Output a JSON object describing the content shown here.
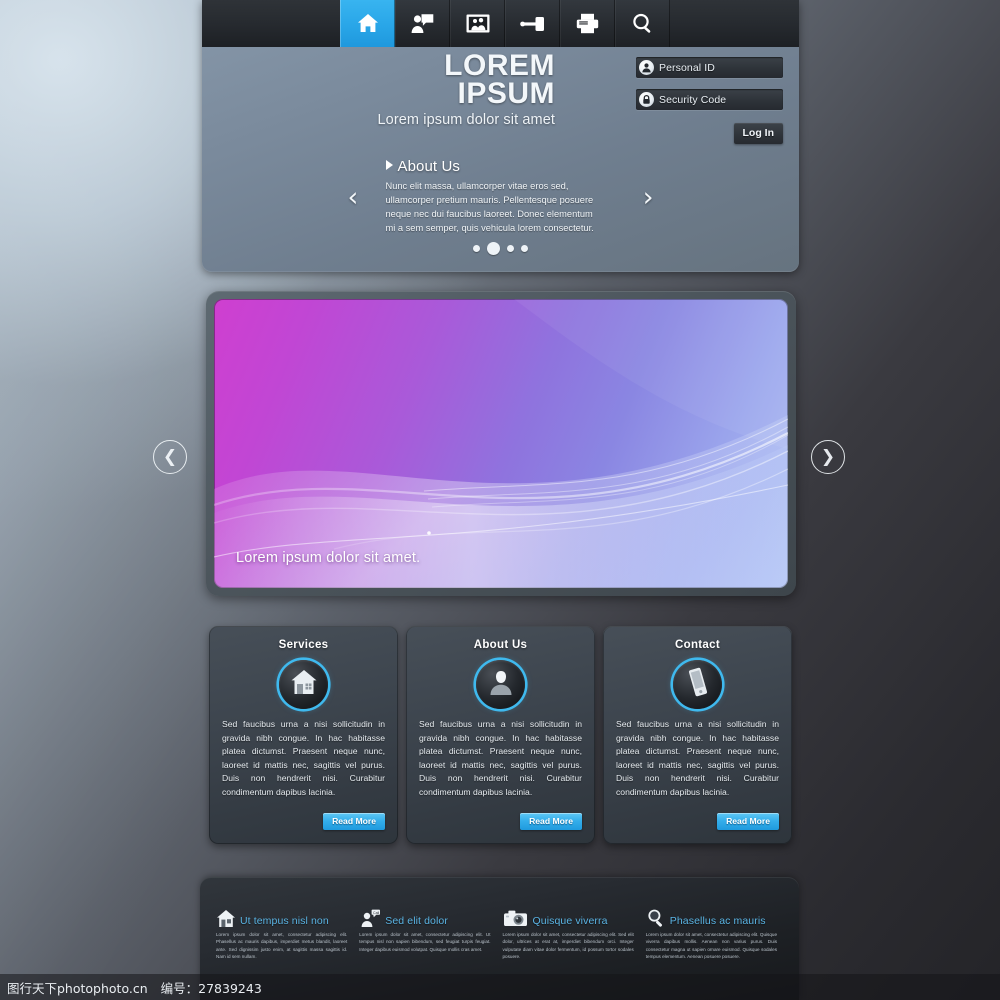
{
  "nav": {
    "items": [
      {
        "name": "home",
        "icon": "home-icon",
        "active": true
      },
      {
        "name": "messages",
        "icon": "user-speech-bubble-icon",
        "active": false
      },
      {
        "name": "gallery",
        "icon": "photo-frame-icon",
        "active": false
      },
      {
        "name": "access",
        "icon": "key-icon",
        "active": false
      },
      {
        "name": "print",
        "icon": "printer-icon",
        "active": false
      },
      {
        "name": "search",
        "icon": "magnifier-icon",
        "active": false
      }
    ]
  },
  "brand": {
    "line1": "LOREM",
    "line2": "IPSUM",
    "tagline": "Lorem ipsum dolor sit amet"
  },
  "login": {
    "personal_id_label": "Personal ID",
    "personal_id_value": "",
    "security_code_label": "Security Code",
    "security_code_value": "",
    "login_button": "Log In",
    "user_icon": "user-avatar-icon",
    "lock_icon": "padlock-icon"
  },
  "about_slider": {
    "title": "About Us",
    "body": "Nunc elit massa, ullamcorper vitae eros sed, ullamcorper pretium mauris. Pellentesque posuere neque nec dui faucibus laoreet. Donec elementum mi a sem semper, quis vehicula lorem consectetur.",
    "prev_glyph": "‹",
    "next_glyph": "›",
    "dots": 4,
    "active_dot": 1
  },
  "banner": {
    "caption": "Lorem ipsum dolor sit amet.",
    "prev_glyph": "❮",
    "next_glyph": "❯",
    "colors": {
      "magenta": "#cf3fd0",
      "violet": "#8f73de",
      "periwinkle": "#b0c2f4"
    }
  },
  "cards": [
    {
      "title": "Services",
      "icon": "house-icon",
      "text": "Sed faucibus urna a nisi sollicitudin in gravida nibh congue. In hac habitasse platea dictumst. Praesent neque nunc, laoreet id mattis nec, sagittis vel purus. Duis non hendrerit nisi. Curabitur condimentum dapibus lacinia.",
      "button": "Read More"
    },
    {
      "title": "About Us",
      "icon": "person-silhouette-icon",
      "text": "Sed faucibus urna a nisi sollicitudin in gravida nibh congue. In hac habitasse platea dictumst. Praesent neque nunc, laoreet id mattis nec, sagittis vel purus. Duis non hendrerit nisi. Curabitur condimentum dapibus lacinia.",
      "button": "Read More"
    },
    {
      "title": "Contact",
      "icon": "mobile-phone-icon",
      "text": "Sed faucibus urna a nisi sollicitudin in gravida nibh congue. In hac habitasse platea dictumst. Praesent neque nunc, laoreet id mattis nec, sagittis vel purus. Duis non hendrerit nisi. Curabitur condimentum dapibus lacinia.",
      "button": "Read More"
    }
  ],
  "footer": [
    {
      "title": "Ut tempus nisl non",
      "icon": "house-icon",
      "text": "Lorem ipsum dolor sit amet, consectetur adipiscing elit. Phasellus ac mauris dapibus, imperdiet metus blandit, laoreet ante. Sed dignissim justo enim, at sagittis massa sagittis id. Nam id sem nullam."
    },
    {
      "title": "Sed elit dolor",
      "icon": "person-call-icon",
      "text": "Lorem ipsum dolor sit amet, consectetur adipiscing elit. Ut tempus nisl non sapien bibendum, sed feugiat turpis feugiat. Integer dapibus euismod volutpat. Quisque mollis cras amet."
    },
    {
      "title": "Quisque viverra",
      "icon": "camera-icon",
      "text": "Lorem ipsum dolor sit amet, consectetur adipiscing elit. Sed elit dolor, ultrices at erat at, imperdiet bibendum orci. Integer vulputate diam vitae dolor fermentum, id possum tortor sodales posuere."
    },
    {
      "title": "Phasellus ac mauris",
      "icon": "magnifier-icon",
      "text": "Lorem ipsum dolor sit amet, consectetur adipiscing elit. Quisque viverra dapibus mollis. Aenean non varius purus. Duis consectetur magna ut sapien ornare euismod. Quisque sodales tempus elementum. Aenean posuere posuere."
    }
  ],
  "watermark": {
    "site": "图行天下photophoto.cn",
    "id": "编号：27839243"
  }
}
